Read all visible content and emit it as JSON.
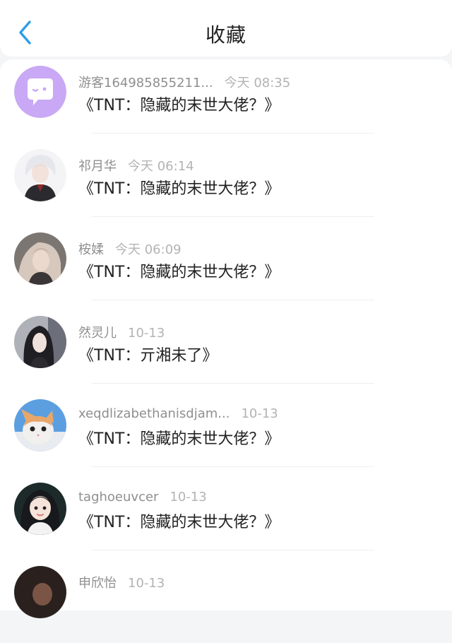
{
  "header": {
    "title": "收藏"
  },
  "items": [
    {
      "user": "游客164985855211...",
      "time": "今天 08:35",
      "text": "《TNT：隐藏的末世大佬？》",
      "avatar_icon": "chat-bubble-icon"
    },
    {
      "user": "祁月华",
      "time": "今天 06:14",
      "text": "《TNT：隐藏的末世大佬？》",
      "avatar_icon": "anime-character-avatar"
    },
    {
      "user": "桉媃",
      "time": "今天 06:09",
      "text": "《TNT：隐藏的末世大佬？》",
      "avatar_icon": "girl-photo-avatar"
    },
    {
      "user": "然灵儿",
      "time": "10-13",
      "text": "《TNT：亓湘未了》",
      "avatar_icon": "dark-portrait-avatar"
    },
    {
      "user": "xeqdlizabethanisdjam...",
      "time": "10-13",
      "text": "《TNT：隐藏的末世大佬？》",
      "avatar_icon": "kitten-avatar"
    },
    {
      "user": "taghoeuvcer",
      "time": "10-13",
      "text": "《TNT：隐藏的末世大佬？》",
      "avatar_icon": "child-photo-avatar"
    },
    {
      "user": "申欣怡",
      "time": "10-13",
      "text": "",
      "avatar_icon": "dark-avatar"
    }
  ],
  "colors": {
    "accent": "#2f9ee8",
    "default_avatar_bg": "#c9a8f5"
  }
}
